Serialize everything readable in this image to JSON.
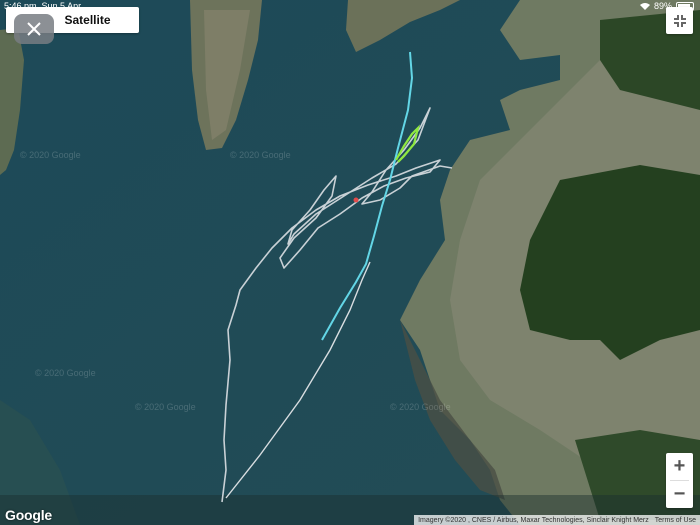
{
  "status_bar": {
    "time": "5:46 pm",
    "date": "Sun 5 Apr",
    "battery": "89%"
  },
  "map": {
    "type_label": "Satellite",
    "watermark": "© 2020 Google",
    "logo": "Google",
    "attribution": "Imagery ©2020 , CNES / Airbus, Maxar Technologies, Sinclair Knight Merz",
    "terms": "Terms of Use",
    "zoom_in": "+",
    "zoom_out": "−"
  },
  "colors": {
    "water": "#1f4a5a",
    "track_main": "#c9d1d6",
    "track_cyan": "#63d6e6",
    "track_green": "#8fe840"
  },
  "icons": {
    "close": "close-icon",
    "fullscreen": "fullscreen-icon",
    "wifi": "wifi-icon",
    "battery": "battery-icon"
  }
}
